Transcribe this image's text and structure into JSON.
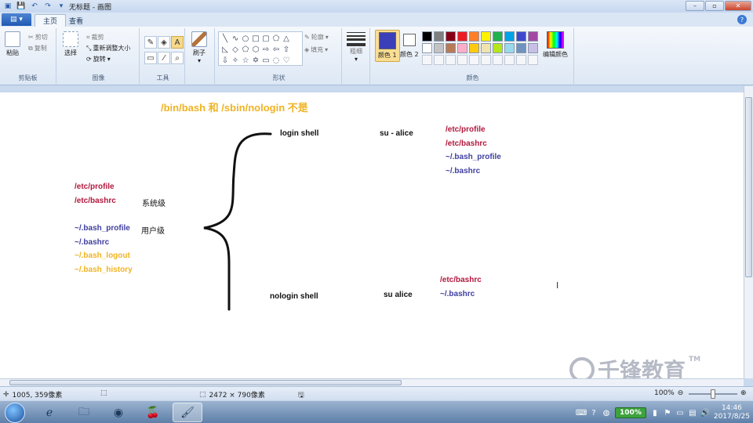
{
  "window": {
    "title": "无标题 - 画图",
    "quick_access": [
      "save-icon",
      "undo-icon",
      "redo-icon",
      "dropdown-icon"
    ],
    "minimize": "–",
    "maximize": "▫",
    "close": "✕"
  },
  "tabs": {
    "app_menu": "▤ ▾",
    "home": "主页",
    "view": "查看"
  },
  "ribbon": {
    "clipboard": {
      "label": "剪贴板",
      "paste": "粘贴",
      "cut": "剪切",
      "copy": "复制"
    },
    "image": {
      "label": "图像",
      "select": "选择",
      "crop": "裁剪",
      "resize": "重新调整大小",
      "rotate": "旋转"
    },
    "tools": {
      "label": "工具"
    },
    "brushes": {
      "label": "刷子"
    },
    "shapes": {
      "label": "形状",
      "outline": "轮廓",
      "fill": "填充"
    },
    "size": {
      "label": "粗细"
    },
    "colors": {
      "label": "颜色",
      "color1": "颜色 1",
      "color2": "颜色 2",
      "edit_colors": "编辑颜色",
      "color1_value": "#3b3fb8",
      "color2_value": "#ffffff",
      "palette_row1": [
        "#000000",
        "#7f7f7f",
        "#880015",
        "#ed1c24",
        "#ff7f27",
        "#fff200",
        "#22b14c",
        "#00a2e8",
        "#3f48cc",
        "#a349a4"
      ],
      "palette_row2": [
        "#ffffff",
        "#c3c3c3",
        "#b97a57",
        "#ffaec9",
        "#ffc90e",
        "#efe4b0",
        "#b5e61d",
        "#99d9ea",
        "#7092be",
        "#c8bfe7"
      ]
    }
  },
  "canvas": {
    "heading": "/bin/bash   和 /sbin/nologin  不是",
    "left_block": {
      "etc_profile": "/etc/profile",
      "etc_bashrc": "/etc/bashrc",
      "system_level": "系统级",
      "bash_profile": "~/.bash_profile",
      "user_level": "用户级",
      "bashrc": "~/.bashrc",
      "bash_logout": "~/.bash_logout",
      "bash_history": "~/.bash_history"
    },
    "login": {
      "label": "login shell",
      "command": "su - alice",
      "files": [
        "/etc/profile",
        "/etc/bashrc",
        "~/.bash_profile",
        "~/.bashrc"
      ]
    },
    "nologin": {
      "label": "nologin shell",
      "command": "su alice",
      "files": [
        "/etc/bashrc",
        "~/.bashrc"
      ]
    },
    "watermark": "千锋教育",
    "watermark_tm": "TM"
  },
  "status": {
    "cursor_pos": "1005, 359像素",
    "canvas_size": "2472 × 790像素",
    "zoom": "100%"
  },
  "taskbar": {
    "battery": "100%",
    "time": "14:46",
    "date": "2017/8/25"
  }
}
